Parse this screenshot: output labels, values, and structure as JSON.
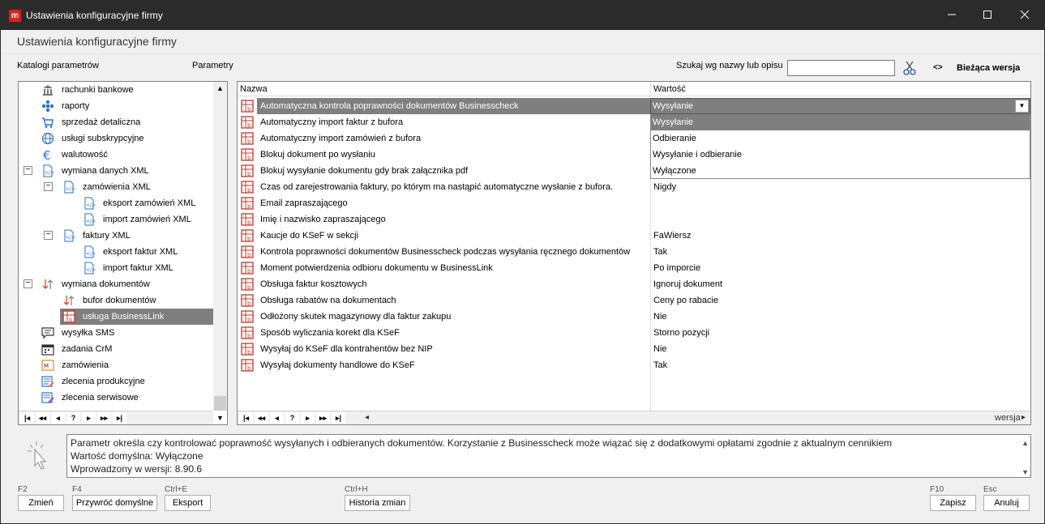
{
  "window": {
    "title": "Ustawienia konfiguracyjne firmy",
    "app_icon_letter": "m"
  },
  "header": {
    "title": "Ustawienia konfiguracyjne firmy"
  },
  "toolbar": {
    "catalogs_label": "Katalogi parametrów",
    "params_label": "Parametry",
    "search_label": "Szukaj wg nazwy lub opisu",
    "search_value": "",
    "version_toggle": "<>",
    "current_version": "Bieżąca wersja"
  },
  "tree": {
    "items": [
      {
        "label": "rachunki bankowe",
        "icon": "bank-icon"
      },
      {
        "label": "raporty",
        "icon": "reports-icon"
      },
      {
        "label": "sprzedaż detaliczna",
        "icon": "cart-icon"
      },
      {
        "label": "usługi subskrypcyjne",
        "icon": "globe-icon"
      },
      {
        "label": "walutowość",
        "icon": "euro-icon"
      },
      {
        "label": "wymiana danych XML",
        "icon": "xml-file-icon",
        "expander": "−"
      },
      {
        "label": "zamówienia XML",
        "icon": "xml-file-icon",
        "expander": "−"
      },
      {
        "label": "eksport zamówień XML",
        "icon": "xml-file-icon"
      },
      {
        "label": "import zamówień XML",
        "icon": "xml-file-icon"
      },
      {
        "label": "faktury XML",
        "icon": "xml-file-icon",
        "expander": "−"
      },
      {
        "label": "eksport faktur XML",
        "icon": "xml-file-icon"
      },
      {
        "label": "import faktur XML",
        "icon": "xml-file-icon"
      },
      {
        "label": "wymiana dokumentów",
        "icon": "exchange-icon",
        "expander": "−"
      },
      {
        "label": "bufor dokumentów",
        "icon": "exchange-icon"
      },
      {
        "label": "usługa BusinessLink",
        "icon": "businesslink-icon",
        "selected": true
      },
      {
        "label": "wysyłka SMS",
        "icon": "sms-icon"
      },
      {
        "label": "zadania CrM",
        "icon": "calendar-icon"
      },
      {
        "label": "zamówienia",
        "icon": "orders-icon"
      },
      {
        "label": "zlecenia produkcyjne",
        "icon": "production-icon"
      },
      {
        "label": "zlecenia serwisowe",
        "icon": "service-icon"
      }
    ],
    "nav": [
      "|◂",
      "◂◂",
      "◂",
      "?",
      "▸",
      "▸▸",
      "▸|"
    ]
  },
  "grid": {
    "col_name": "Nazwa",
    "col_value": "Wartość",
    "rows": [
      {
        "name": "Automatyczna kontrola poprawności dokumentów Businesscheck",
        "value": "",
        "selected": true
      },
      {
        "name": "Automatyczny import faktur z bufora",
        "value": ""
      },
      {
        "name": "Automatyczny import zamówień z bufora",
        "value": ""
      },
      {
        "name": "Blokuj dokument po wysłaniu",
        "value": ""
      },
      {
        "name": "Blokuj wysyłanie dokumentu gdy brak załącznika pdf",
        "value": ""
      },
      {
        "name": "Czas od zarejestrowania faktury, po którym ma nastąpić automatyczne wysłanie z bufora.",
        "value": "Nigdy"
      },
      {
        "name": "Email zapraszającego",
        "value": ""
      },
      {
        "name": "Imię i nazwisko zapraszającego",
        "value": ""
      },
      {
        "name": "Kaucje do KSeF w sekcji",
        "value": "FaWiersz"
      },
      {
        "name": "Kontrola poprawności dokumentów Businesscheck podczas wysyłania ręcznego dokumentów",
        "value": "Tak"
      },
      {
        "name": "Moment potwierdzenia odbioru dokumentu w BusinessLink",
        "value": "Po imporcie"
      },
      {
        "name": "Obsługa faktur kosztowych",
        "value": "Ignoruj dokument"
      },
      {
        "name": "Obsługa rabatów na dokumentach",
        "value": "Ceny po rabacie"
      },
      {
        "name": "Odłożony skutek magazynowy dla faktur zakupu",
        "value": "Nie"
      },
      {
        "name": "Sposób wyliczania korekt dla KSeF",
        "value": "Storno pozycji"
      },
      {
        "name": "Wysyłaj do KSeF dla kontrahentów bez NIP",
        "value": "Nie"
      },
      {
        "name": "Wysyłaj dokumenty handlowe do KSeF",
        "value": "Tak"
      }
    ],
    "dropdown": {
      "value": "Wysyłanie",
      "options": [
        "Wysyłanie",
        "Odbieranie",
        "Wysyłanie i odbieranie",
        "Wyłączone"
      ],
      "selected_index": 0
    },
    "nav": [
      "|◂",
      "◂◂",
      "◂",
      "?",
      "▸",
      "▸▸",
      "▸|"
    ],
    "hscroll_right": "wersja"
  },
  "description": {
    "line1": "Parametr określa czy kontrolować poprawność wysyłanych i odbieranych dokumentów. Korzystanie z Businesscheck może wiązać się z dodatkowymi opłatami zgodnie z aktualnym cennikiem",
    "line2": "Wartość domyślna: Wyłączone",
    "line3": "Wprowadzony w wersji: 8.90.6"
  },
  "footer": {
    "change": {
      "key": "F2",
      "label": "Zmień"
    },
    "restore": {
      "key": "F4",
      "label": "Przywróć domyślne"
    },
    "export": {
      "key": "Ctrl+E",
      "label": "Eksport"
    },
    "history": {
      "key": "Ctrl+H",
      "label": "Historia zmian"
    },
    "save": {
      "key": "F10",
      "label": "Zapisz"
    },
    "cancel": {
      "key": "Esc",
      "label": "Anuluj"
    }
  },
  "colors": {
    "titlebar": "#2b2b2b",
    "selection": "#7f7f7f",
    "app_icon": "#d82020",
    "param_icon": "#c0392b"
  }
}
